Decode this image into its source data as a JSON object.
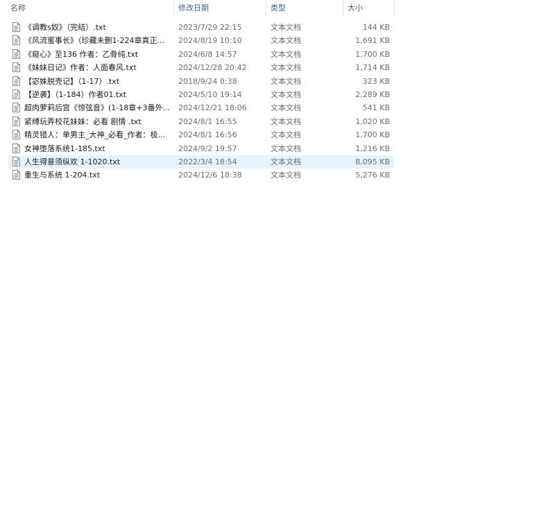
{
  "columns": {
    "name": "名称",
    "date": "修改日期",
    "type": "类型",
    "size": "大小"
  },
  "sort": {
    "column": "name",
    "icon": "chevron-up-icon",
    "glyph": "^"
  },
  "files": [
    {
      "name": "《调教s奴》（完结）.txt",
      "date": "2023/7/29 22:15",
      "type": "文本文档",
      "size": "144 KB"
    },
    {
      "name": "《风流蜜事长》（珍藏未删1-224章真正...",
      "date": "2024/8/19 10:10",
      "type": "文本文档",
      "size": "1,691 KB"
    },
    {
      "name": "《窥心》至136 作者：乙骨纯.txt",
      "date": "2024/6/8 14:57",
      "type": "文本文档",
      "size": "1,700 KB"
    },
    {
      "name": "《妹妹日记》作者：人面春风.txt",
      "date": "2024/12/28 20:42",
      "type": "文本文档",
      "size": "1,714 KB"
    },
    {
      "name": "【宓姝脱壳记】（1-17）.txt",
      "date": "2018/9/24 0:38",
      "type": "文本文档",
      "size": "323 KB"
    },
    {
      "name": "【逆袭】（1-184）作者01.txt",
      "date": "2024/5/10 19:14",
      "type": "文本文档",
      "size": "2,289 KB"
    },
    {
      "name": "超肉萝莉后宫《惊弦音》(1-18章+3番外...",
      "date": "2024/12/21 18:06",
      "type": "文本文档",
      "size": "541 KB"
    },
    {
      "name": "紧缚玩弄校花妹妹：必看 剧情 .txt",
      "date": "2024/8/1 16:55",
      "type": "文本文档",
      "size": "1,020 KB"
    },
    {
      "name": "精灵猎人：单男主_大神_必看_作者：极...",
      "date": "2024/8/1 16:56",
      "type": "文本文档",
      "size": "1,700 KB"
    },
    {
      "name": "女神堕落系统1-185.txt",
      "date": "2024/9/2 19:57",
      "type": "文本文档",
      "size": "1,216 KB"
    },
    {
      "name": "人生得意须纵欢 1-1020.txt",
      "date": "2022/3/4 18:54",
      "type": "文本文档",
      "size": "8,095 KB",
      "selected": true
    },
    {
      "name": "重生与系统 1-204.txt",
      "date": "2024/12/6 18:38",
      "type": "文本文档",
      "size": "5,276 KB"
    }
  ],
  "icon": "text-file-icon"
}
